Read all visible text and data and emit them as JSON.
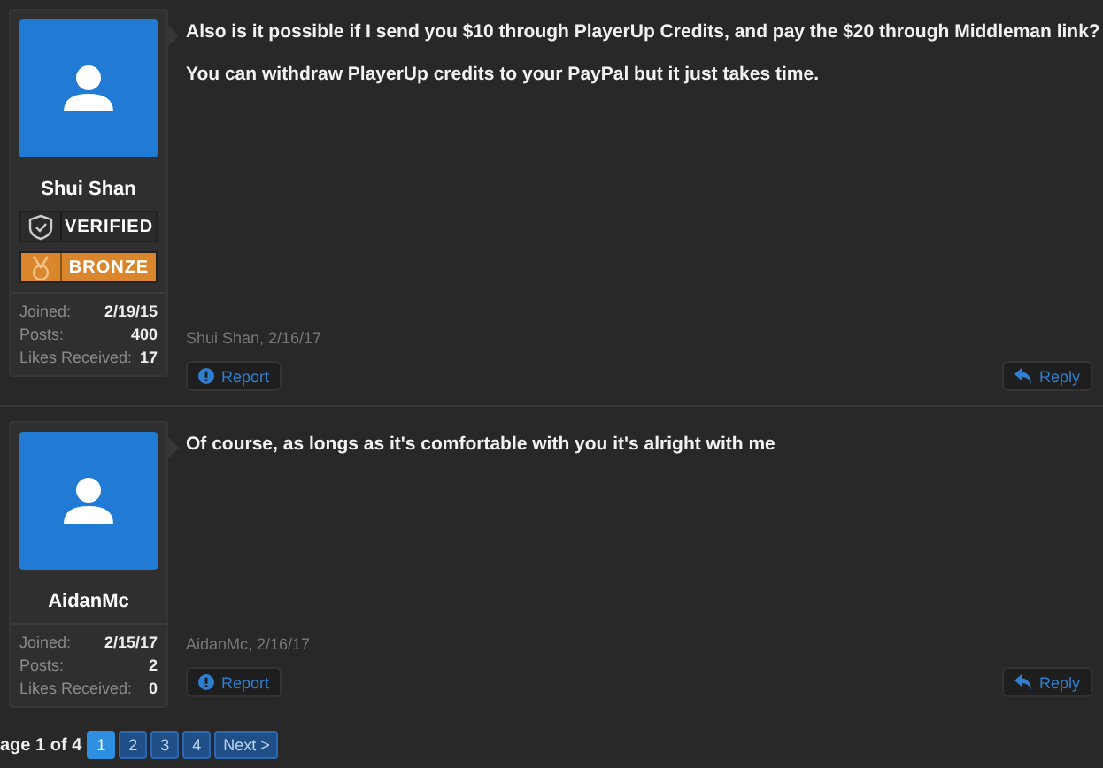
{
  "posts": [
    {
      "author": "Shui Shan",
      "badges": [
        {
          "kind": "shield",
          "label": "VERIFIED",
          "color": "#2b2b2b"
        },
        {
          "kind": "medal",
          "label": "BRONZE",
          "color": "#d9862c"
        }
      ],
      "stats": [
        {
          "label": "Joined:",
          "value": "2/19/15"
        },
        {
          "label": "Posts:",
          "value": "400"
        },
        {
          "label": "Likes Received:",
          "value": "17"
        }
      ],
      "paragraphs": [
        "Also is it possible if I send you $10 through PlayerUp Credits, and pay the $20 through Middleman link?",
        "You can withdraw PlayerUp credits to your PayPal but it just takes time."
      ],
      "meta": "Shui Shan, 2/16/17",
      "report": "Report",
      "reply": "Reply"
    },
    {
      "author": "AidanMc",
      "stats": [
        {
          "label": "Joined:",
          "value": "2/15/17"
        },
        {
          "label": "Posts:",
          "value": "2"
        },
        {
          "label": "Likes Received:",
          "value": "0"
        }
      ],
      "paragraphs": [
        "Of course, as longs as it's comfortable with you it's alright with me"
      ],
      "meta": "AidanMc, 2/16/17",
      "report": "Report",
      "reply": "Reply"
    }
  ],
  "pagination": {
    "label": "age 1 of 4",
    "pages": [
      {
        "label": "1",
        "selected": true
      },
      {
        "label": "2",
        "selected": false
      },
      {
        "label": "3",
        "selected": false
      },
      {
        "label": "4",
        "selected": false
      }
    ],
    "next": "Next >"
  }
}
